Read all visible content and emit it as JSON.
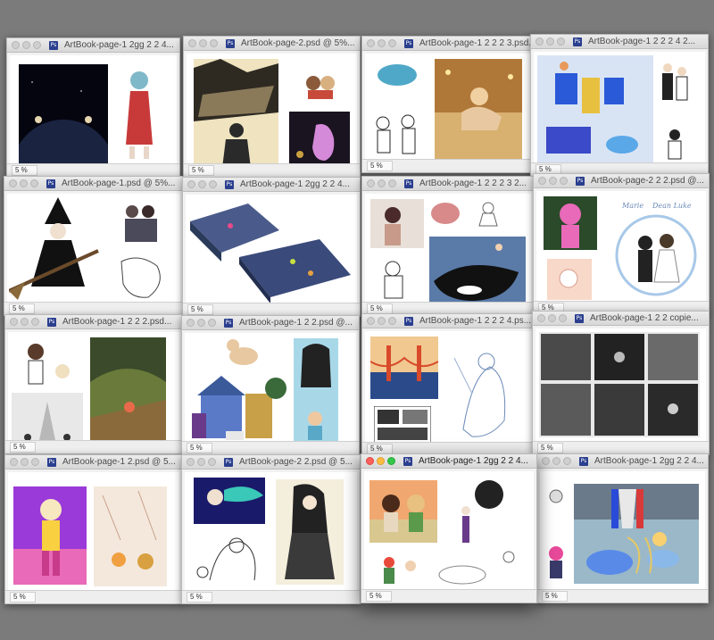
{
  "windows": [
    {
      "title": "ArtBook-page-1 2gg 2 2 4...",
      "zoom": "5 %"
    },
    {
      "title": "ArtBook-page-2.psd @ 5%...",
      "zoom": "5 %"
    },
    {
      "title": "ArtBook-page-1 2 2 2 3.psd...",
      "zoom": "5 %"
    },
    {
      "title": "ArtBook-page-1 2 2 2 4 2...",
      "zoom": "5 %"
    },
    {
      "title": "ArtBook-page-1.psd @ 5%...",
      "zoom": "5 %"
    },
    {
      "title": "ArtBook-page-1 2gg 2 2 4...",
      "zoom": "5 %"
    },
    {
      "title": "ArtBook-page-1 2 2 2 3 2...",
      "zoom": "5 %"
    },
    {
      "title": "ArtBook-page-2 2 2.psd @...",
      "zoom": "5 %"
    },
    {
      "title": "ArtBook-page-1 2 2 2.psd...",
      "zoom": "5 %"
    },
    {
      "title": "ArtBook-page-1 2 2.psd @...",
      "zoom": "5 %"
    },
    {
      "title": "ArtBook-page-1 2 2 2 4.ps...",
      "zoom": "5 %"
    },
    {
      "title": "ArtBook-page-1 2 2 copie...",
      "zoom": "5 %"
    },
    {
      "title": "ArtBook-page-1 2.psd @ 5...",
      "zoom": "5 %"
    },
    {
      "title": "ArtBook-page-2 2.psd @ 5...",
      "zoom": "5 %"
    },
    {
      "title": "ArtBook-page-1 2gg 2 2 4...",
      "zoom": "5 %"
    },
    {
      "title": "ArtBook-page-1 2gg 2 2 4...",
      "zoom": "5 %"
    }
  ],
  "ps_icon_text": "Ps",
  "artwork": {
    "w8": [
      "Marie",
      "Dean Luke"
    ]
  },
  "colors": {
    "desktop": "#7b7b7b",
    "titlebar": "#dcdcdc",
    "close": "#fc605b",
    "minimize": "#fdbc40",
    "maximize": "#34c84a"
  }
}
